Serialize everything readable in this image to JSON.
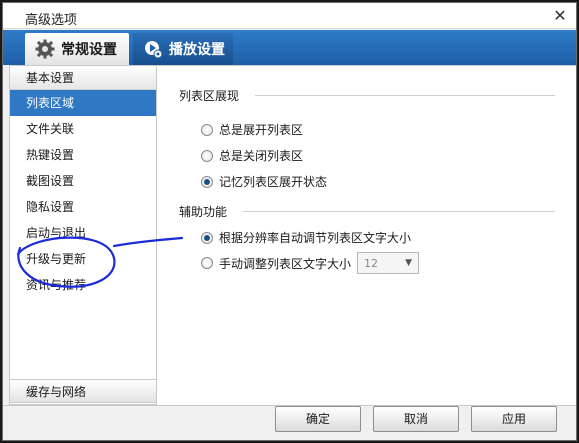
{
  "window": {
    "title": "高级选项",
    "close_glyph": "✕"
  },
  "tabs": [
    {
      "label": "常规设置",
      "icon": "gear-icon",
      "active": true
    },
    {
      "label": "播放设置",
      "icon": "play-settings-icon",
      "active": false
    }
  ],
  "sidebar": {
    "header": "基本设置",
    "items": [
      {
        "label": "列表区域",
        "selected": true
      },
      {
        "label": "文件关联"
      },
      {
        "label": "热键设置"
      },
      {
        "label": "截图设置"
      },
      {
        "label": "隐私设置"
      },
      {
        "label": "启动与退出"
      },
      {
        "label": "升级与更新"
      },
      {
        "label": "资讯与推荐"
      }
    ],
    "footer": "缓存与网络"
  },
  "list_section": {
    "title": "列表区展现",
    "options": [
      {
        "label": "总是展开列表区",
        "checked": false
      },
      {
        "label": "总是关闭列表区",
        "checked": false
      },
      {
        "label": "记忆列表区展开状态",
        "checked": true
      }
    ]
  },
  "assist_section": {
    "title": "辅助功能",
    "options": [
      {
        "label": "根据分辨率自动调节列表区文字大小",
        "checked": true
      },
      {
        "label": "手动调整列表区文字大小",
        "checked": false
      }
    ],
    "font_size_value": "12"
  },
  "buttons": {
    "ok": "确定",
    "cancel": "取消",
    "apply": "应用"
  },
  "colors": {
    "accent": "#2e78c4",
    "tabbar": "#1e5fa6",
    "annotation": "#1a2bdb"
  }
}
